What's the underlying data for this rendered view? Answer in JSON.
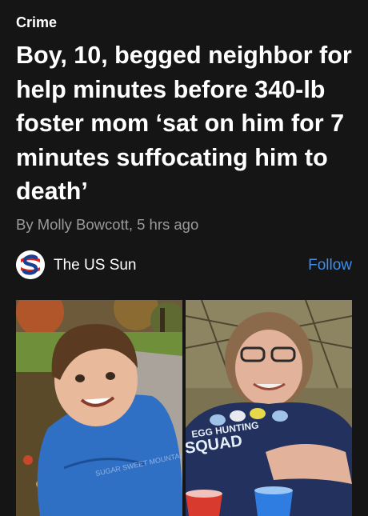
{
  "category": "Crime",
  "headline": "Boy, 10, begged neighbor for help minutes before 340-lb foster mom ‘sat on him for 7 minutes suffocating him to death’",
  "byline": "By Molly Bowcott, 5 hrs ago",
  "publisher": {
    "name": "The US Sun",
    "logo_icon": "us-sun-logo-icon",
    "follow_label": "Follow"
  },
  "photos": {
    "right_shirt_text": [
      "EGG HUNTING",
      "SQUAD"
    ],
    "left_shirt_text": "SUGAR SWEET MOUNTAINS"
  },
  "colors": {
    "background": "#151515",
    "byline": "#9a9a9a",
    "follow": "#3d8ef0",
    "logo_red": "#e0241b"
  }
}
